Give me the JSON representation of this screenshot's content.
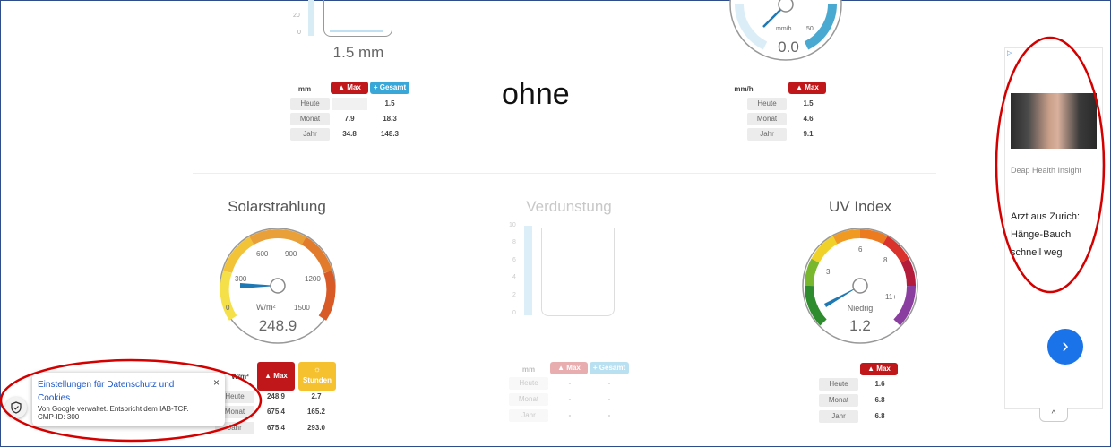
{
  "rain": {
    "axis_ticks": [
      "20",
      "0"
    ],
    "value": "1.5 mm",
    "unit": "mm",
    "max_label": "Max",
    "total_label": "Gesamt",
    "rows": [
      {
        "label": "Heute",
        "max": "",
        "total": "1.5"
      },
      {
        "label": "Monat",
        "max": "7.9",
        "total": "18.3"
      },
      {
        "label": "Jahr",
        "max": "34.8",
        "total": "148.3"
      }
    ]
  },
  "annotation": "ohne",
  "wind": {
    "unit_inner": "mm/h",
    "tick": "50",
    "value": "0.0",
    "unit": "mm/h",
    "max_label": "Max",
    "rows": [
      {
        "label": "Heute",
        "max": "1.5"
      },
      {
        "label": "Monat",
        "max": "4.6"
      },
      {
        "label": "Jahr",
        "max": "9.1"
      }
    ]
  },
  "solar": {
    "title": "Solarstrahlung",
    "ticks": [
      "0",
      "300",
      "600",
      "900",
      "1200",
      "1500"
    ],
    "unit_inner": "W/m²",
    "value": "248.9",
    "value_numeric": 248.9,
    "unit": "W/m²",
    "max_label": "Max",
    "hours_label": "Stunden",
    "rows": [
      {
        "label": "Heute",
        "max": "248.9",
        "hours": "2.7"
      },
      {
        "label": "Monat",
        "max": "675.4",
        "hours": "165.2"
      },
      {
        "label": "Jahr",
        "max": "675.4",
        "hours": "293.0"
      }
    ]
  },
  "evap": {
    "title": "Verdunstung",
    "axis_ticks": [
      "10",
      "8",
      "6",
      "4",
      "2",
      "0"
    ],
    "unit": "mm",
    "max_label": "Max",
    "total_label": "Gesamt",
    "rows": [
      {
        "label": "Heute",
        "max": "-",
        "total": "-"
      },
      {
        "label": "Monat",
        "max": "-",
        "total": "-"
      },
      {
        "label": "Jahr",
        "max": "-",
        "total": "-"
      }
    ]
  },
  "uv": {
    "title": "UV Index",
    "ticks": [
      "3",
      "6",
      "8",
      "11+"
    ],
    "level": "Niedrig",
    "value": "1.2",
    "value_numeric": 1.2,
    "max_label": "Max",
    "rows": [
      {
        "label": "Heute",
        "max": "1.6"
      },
      {
        "label": "Monat",
        "max": "6.8"
      },
      {
        "label": "Jahr",
        "max": "6.8"
      }
    ]
  },
  "ad": {
    "source": "Deap Health Insight",
    "headline_lines": [
      "Arzt aus Zurich:",
      "Hänge-Bauch",
      "schnell weg"
    ],
    "next_glyph": "›",
    "collapse_glyph": "^"
  },
  "consent": {
    "title": "Einstellungen für Datenschutz und Cookies",
    "text_line1": "Von Google verwaltet. Entspricht dem IAB-TCF.",
    "text_line2": "CMP-ID: 300",
    "close": "×"
  },
  "colors": {
    "max_red": "#c0171b",
    "total_blue": "#39a8d8",
    "hours_yellow": "#f6c12f",
    "needle": "#1e78b4",
    "annotation_red": "#d40000"
  }
}
